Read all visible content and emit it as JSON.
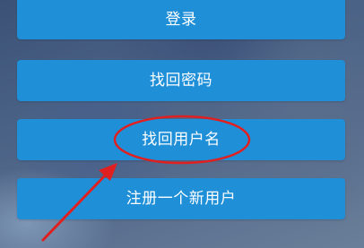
{
  "buttons": {
    "login": "登录",
    "recover_password": "找回密码",
    "recover_username": "找回用户名",
    "register": "注册一个新用户"
  },
  "annotation": {
    "color": "#e02020"
  },
  "colors": {
    "button_bg": "#1f8fd8",
    "button_text": "#ffffff"
  }
}
